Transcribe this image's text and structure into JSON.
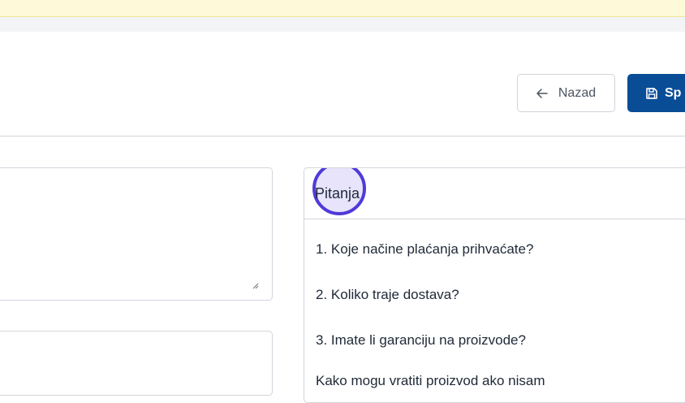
{
  "toolbar": {
    "back_label": "Nazad",
    "save_label": "Sp"
  },
  "questions_panel": {
    "title": "Pitanja",
    "items": [
      "1. Koje načine plaćanja prihvaćate?",
      "2. Koliko traje dostava?",
      "3. Imate li garanciju na proizvode?",
      "Kako mogu vratiti proizvod ako nisam"
    ]
  },
  "colors": {
    "primary": "#0a4d97",
    "focus_ring": "#4f3ad9",
    "success": "#22a34a",
    "banner": "#fdf9d9"
  }
}
